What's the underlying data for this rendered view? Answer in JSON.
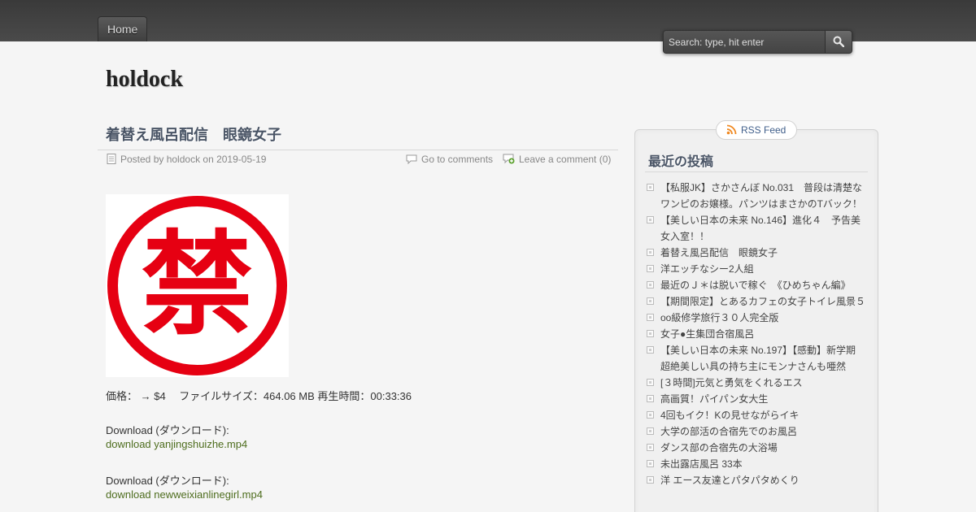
{
  "nav": {
    "home_label": "Home"
  },
  "search": {
    "placeholder": "Search: type, hit enter"
  },
  "site": {
    "title": "holdock"
  },
  "post": {
    "title": "着替え風呂配信　眼鏡女子",
    "posted_by": "Posted by holdock on 2019-05-19",
    "go_to_comments": "Go to comments",
    "leave_comment": "Leave a comment (0)",
    "image_glyph": "禁",
    "price_line": "価格： → $4　 ファイルサイズ：464.06 MB 再生時間：00:33:36",
    "downloads": [
      {
        "label": "Download (ダウンロード):",
        "link": "download yanjingshuizhe.mp4"
      },
      {
        "label": "Download (ダウンロード):",
        "link": "download newweixianlinegirl.mp4"
      }
    ]
  },
  "sidebar": {
    "rss_label": "RSS Feed",
    "widget_title": "最近の投稿",
    "recent_posts": [
      "【私服JK】さかさんぼ No.031　普段は清楚なワンピのお嬢様。パンツはまさかのTバック！",
      "【美しい日本の未来 No.146】進化４　予告美女入室！！",
      "着替え風呂配信　眼鏡女子",
      "洋エッチなシー2人組",
      "最近のＪ＊は脱いで稼ぐ　《ひめちゃん編》",
      "【期間限定】とあるカフェの女子トイレ風景５",
      "oo級修学旅行３０人完全版",
      "女子●生集団合宿風呂",
      "【美しい日本の未来 No.197】【感動】新学期　超絶美しい具の持ち主にモンナさんも唖然",
      "[３時間]元気と勇気をくれるエス",
      "高画質！パイパン女大生",
      "4回もイク！Kの見せながらイキ",
      "大学の部活の合宿先でのお風呂",
      "ダンス部の合宿先の大浴場",
      "未出露店風呂 33本",
      "洋 エース友達とパタパタめくり"
    ]
  },
  "colors": {
    "topbar": "#444444",
    "link_green": "#4e6d1e",
    "title_slate": "#4a5566",
    "stamp_red": "#e60012"
  }
}
